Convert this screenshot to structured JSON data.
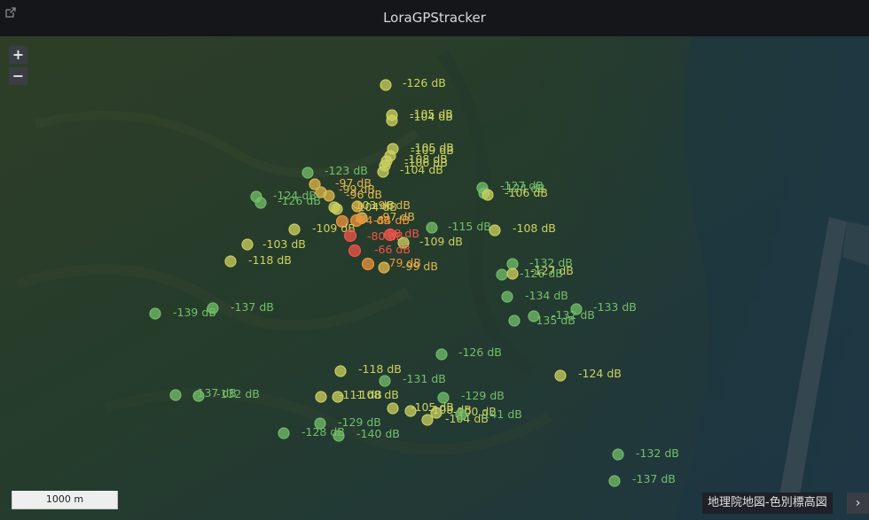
{
  "title": "LoraGPStracker",
  "icons": {
    "external": "external-link-icon",
    "next": "chevron-right-icon"
  },
  "zoom": {
    "in_label": "+",
    "out_label": "−"
  },
  "scale_label": "1000 m",
  "layer_label": "地理院地図-色別標高図",
  "layer_next_label": "›",
  "colors": {
    "green": "#73bf69",
    "yellow": "#cdd25f",
    "amber": "#e0b84e",
    "orange": "#f0963c",
    "red": "#f2554a"
  },
  "points": [
    {
      "rssi": "-126 dB",
      "c": "yellow"
    },
    {
      "rssi": "-105 dB",
      "c": "yellow"
    },
    {
      "rssi": "-104 dB",
      "c": "yellow"
    },
    {
      "rssi": "-105 dB",
      "c": "yellow"
    },
    {
      "rssi": "-109 dB",
      "c": "yellow"
    },
    {
      "rssi": "-108 dB",
      "c": "yellow"
    },
    {
      "rssi": "-106 dB",
      "c": "yellow"
    },
    {
      "rssi": "-104 dB",
      "c": "yellow"
    },
    {
      "rssi": "-123 dB",
      "c": "green"
    },
    {
      "rssi": "-97 dB",
      "c": "amber"
    },
    {
      "rssi": "-99 dB",
      "c": "amber"
    },
    {
      "rssi": "-124 dB",
      "c": "green"
    },
    {
      "rssi": "-126 dB",
      "c": "green"
    },
    {
      "rssi": "-96 dB",
      "c": "amber"
    },
    {
      "rssi": "-103 dB",
      "c": "yellow"
    },
    {
      "rssi": "-104 dB",
      "c": "yellow"
    },
    {
      "rssi": "-96 dB",
      "c": "amber"
    },
    {
      "rssi": "-97 dB",
      "c": "amber"
    },
    {
      "rssi": "-84 dB",
      "c": "orange"
    },
    {
      "rssi": "-84 dB",
      "c": "orange"
    },
    {
      "rssi": "-109 dB",
      "c": "yellow"
    },
    {
      "rssi": "-103 dB",
      "c": "yellow"
    },
    {
      "rssi": "-118 dB",
      "c": "yellow"
    },
    {
      "rssi": "-80 dB",
      "c": "red"
    },
    {
      "rssi": "-68 dB",
      "c": "red"
    },
    {
      "rssi": "-109 dB",
      "c": "yellow"
    },
    {
      "rssi": "-66 dB",
      "c": "red"
    },
    {
      "rssi": "-79 dB",
      "c": "orange"
    },
    {
      "rssi": "-99 dB",
      "c": "amber"
    },
    {
      "rssi": "-115 dB",
      "c": "green"
    },
    {
      "rssi": "-108 dB",
      "c": "yellow"
    },
    {
      "rssi": "-127 dB",
      "c": "green"
    },
    {
      "rssi": "-124 dB",
      "c": "green"
    },
    {
      "rssi": "-106 dB",
      "c": "yellow"
    },
    {
      "rssi": "-132 dB",
      "c": "green"
    },
    {
      "rssi": "-126 dB",
      "c": "green"
    },
    {
      "rssi": "-127 dB",
      "c": "yellow"
    },
    {
      "rssi": "-134 dB",
      "c": "green"
    },
    {
      "rssi": "-132 dB",
      "c": "green"
    },
    {
      "rssi": "-133 dB",
      "c": "green"
    },
    {
      "rssi": "-135 dB",
      "c": "green"
    },
    {
      "rssi": "-139 dB",
      "c": "green"
    },
    {
      "rssi": "-137 dB",
      "c": "green"
    },
    {
      "rssi": "-126 dB",
      "c": "green"
    },
    {
      "rssi": "-118 dB",
      "c": "yellow"
    },
    {
      "rssi": "-131 dB",
      "c": "green"
    },
    {
      "rssi": "-124 dB",
      "c": "yellow"
    },
    {
      "rssi": "-137 dB",
      "c": "green"
    },
    {
      "rssi": "-132 dB",
      "c": "green"
    },
    {
      "rssi": "-111 dB",
      "c": "yellow"
    },
    {
      "rssi": "-108 dB",
      "c": "yellow"
    },
    {
      "rssi": "-129 dB",
      "c": "green"
    },
    {
      "rssi": "-105 dB",
      "c": "yellow"
    },
    {
      "rssi": "-108 dB",
      "c": "yellow"
    },
    {
      "rssi": "-104 dB",
      "c": "yellow"
    },
    {
      "rssi": "-100 dB",
      "c": "yellow"
    },
    {
      "rssi": "-141 dB",
      "c": "green"
    },
    {
      "rssi": "-129 dB",
      "c": "green"
    },
    {
      "rssi": "-128 dB",
      "c": "green"
    },
    {
      "rssi": "-140 dB",
      "c": "green"
    },
    {
      "rssi": "-132 dB",
      "c": "green"
    },
    {
      "rssi": "-137 dB",
      "c": "green"
    }
  ]
}
